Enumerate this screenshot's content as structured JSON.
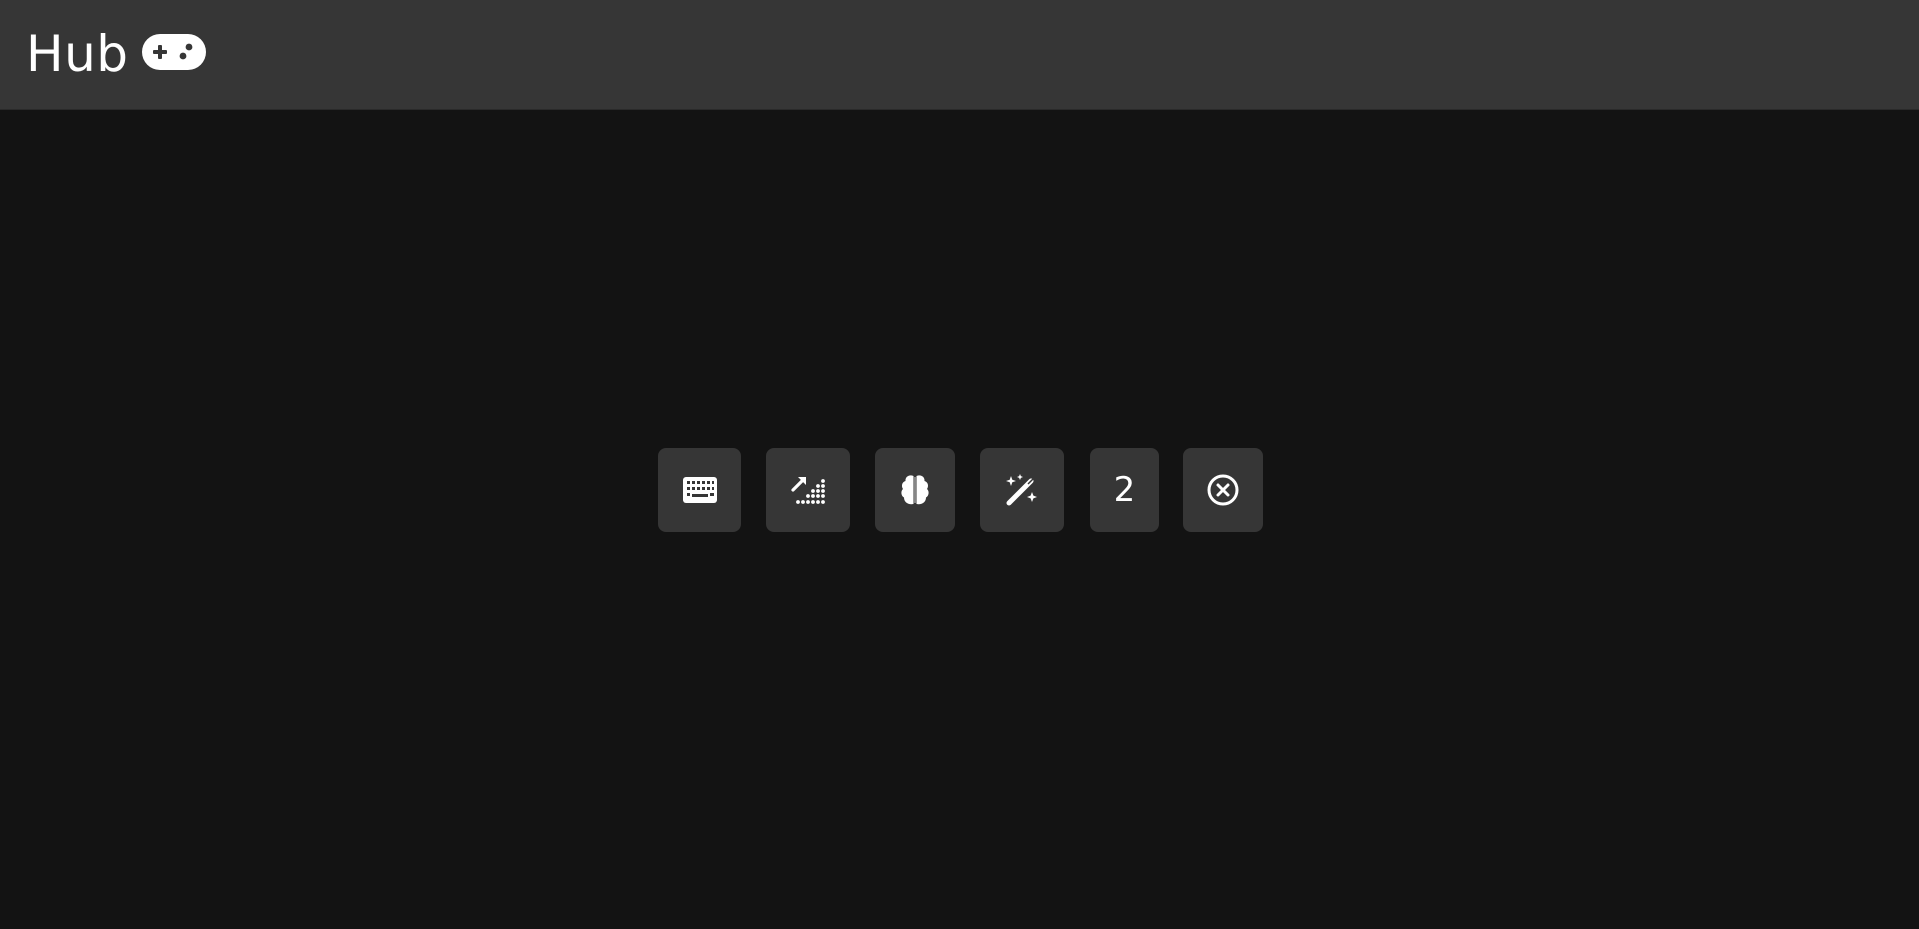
{
  "header": {
    "title": "Hub",
    "logo_icon": "gamepad-icon"
  },
  "toolbar": {
    "buttons": [
      {
        "icon": "keyboard-icon"
      },
      {
        "icon": "trending-dots-icon"
      },
      {
        "icon": "brain-icon"
      },
      {
        "icon": "magic-wand-icon"
      },
      {
        "label": "2"
      },
      {
        "icon": "close-circle-icon"
      }
    ]
  },
  "colors": {
    "background": "#131313",
    "header": "#363636",
    "button": "#363636",
    "foreground": "#ffffff"
  }
}
